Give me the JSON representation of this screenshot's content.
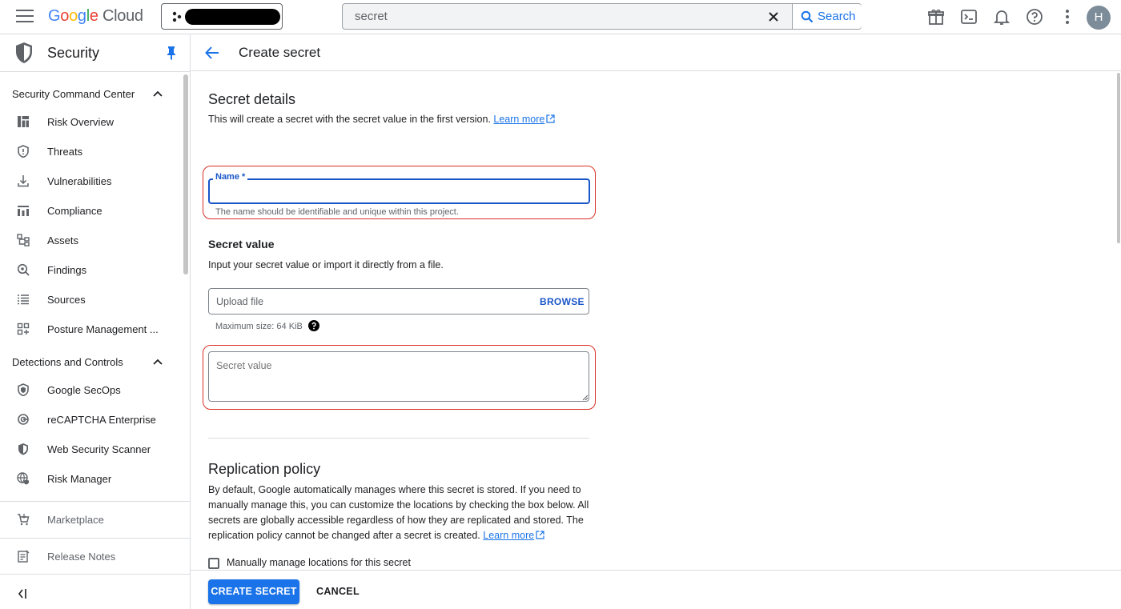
{
  "topbar": {
    "logo": {
      "G": "G",
      "o1": "o",
      "o2": "o",
      "g": "g",
      "l": "l",
      "e": "e",
      "cloud": " Cloud"
    },
    "search": {
      "value": "secret",
      "button_label": "Search"
    },
    "avatar_initial": "H"
  },
  "sidebar": {
    "title": "Security",
    "sections": [
      {
        "label": "Security Command Center",
        "items": [
          {
            "label": "Risk Overview",
            "icon": "dashboard-icon"
          },
          {
            "label": "Threats",
            "icon": "shield-alert-icon"
          },
          {
            "label": "Vulnerabilities",
            "icon": "download-icon"
          },
          {
            "label": "Compliance",
            "icon": "bar-chart-icon"
          },
          {
            "label": "Assets",
            "icon": "hierarchy-icon"
          },
          {
            "label": "Findings",
            "icon": "search-magnify-icon"
          },
          {
            "label": "Sources",
            "icon": "list-icon"
          },
          {
            "label": "Posture Management ...",
            "icon": "grid-icon"
          }
        ]
      },
      {
        "label": "Detections and Controls",
        "items": [
          {
            "label": "Google SecOps",
            "icon": "shield-outline-icon"
          },
          {
            "label": "reCAPTCHA Enterprise",
            "icon": "recaptcha-icon"
          },
          {
            "label": "Web Security Scanner",
            "icon": "shield-half-icon"
          },
          {
            "label": "Risk Manager",
            "icon": "globe-shield-icon"
          }
        ]
      }
    ],
    "bottom": [
      {
        "label": "Marketplace",
        "icon": "cart-icon"
      },
      {
        "label": "Release Notes",
        "icon": "notes-icon"
      }
    ]
  },
  "page": {
    "title": "Create secret",
    "secret_details": {
      "heading": "Secret details",
      "description": "This will create a secret with the secret value in the first version.",
      "learn_more": "Learn more",
      "name_label": "Name *",
      "name_hint": "The name should be identifiable and unique within this project."
    },
    "secret_value": {
      "heading": "Secret value",
      "description": "Input your secret value or import it directly from a file.",
      "upload_placeholder": "Upload file",
      "browse_label": "BROWSE",
      "max_size": "Maximum size: 64 KiB",
      "value_placeholder": "Secret value"
    },
    "replication": {
      "heading": "Replication policy",
      "line1": "By default, Google automatically manages where this secret is stored. If you need to",
      "line2": "manually manage this, you can customize the locations by checking the box below. All",
      "line3": "secrets are globally accessible regardless of how they are replicated and stored. The",
      "line4": "replication policy cannot be changed after a secret is created.",
      "learn_more": "Learn more",
      "checkbox_label": "Manually manage locations for this secret"
    },
    "footer": {
      "create_label": "CREATE SECRET",
      "cancel_label": "CANCEL"
    }
  },
  "colors": {
    "accent": "#1a73e8",
    "highlight": "#d93025"
  }
}
